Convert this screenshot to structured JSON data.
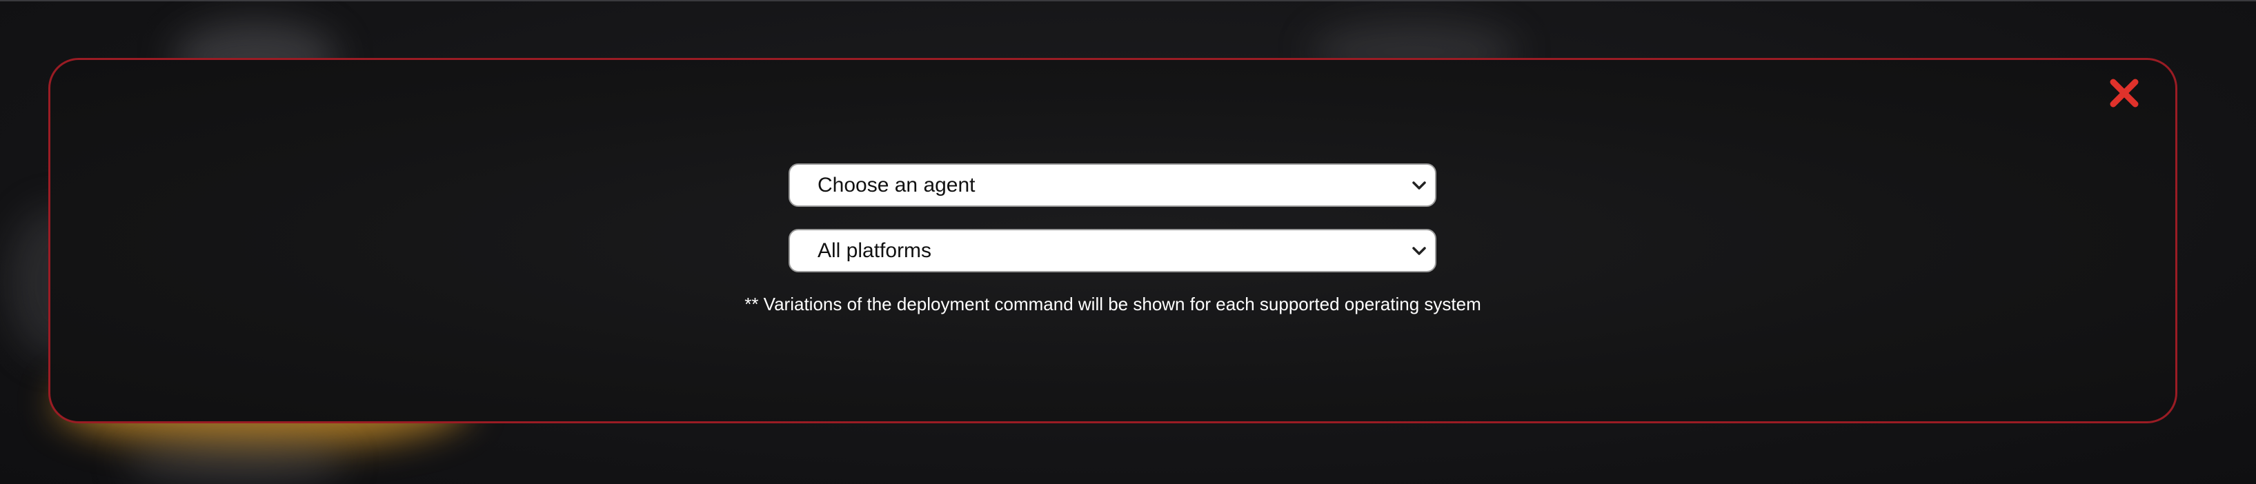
{
  "modal": {
    "accent_color": "#9a1c24",
    "close_icon": "close-icon",
    "close_color": "#e0322b"
  },
  "agent_select": {
    "selected": "Choose an agent",
    "icon": "chevron-down-icon"
  },
  "platform_select": {
    "selected": "All platforms",
    "icon": "chevron-down-icon"
  },
  "note": "** Variations of the deployment command will be shown for each supported operating system"
}
